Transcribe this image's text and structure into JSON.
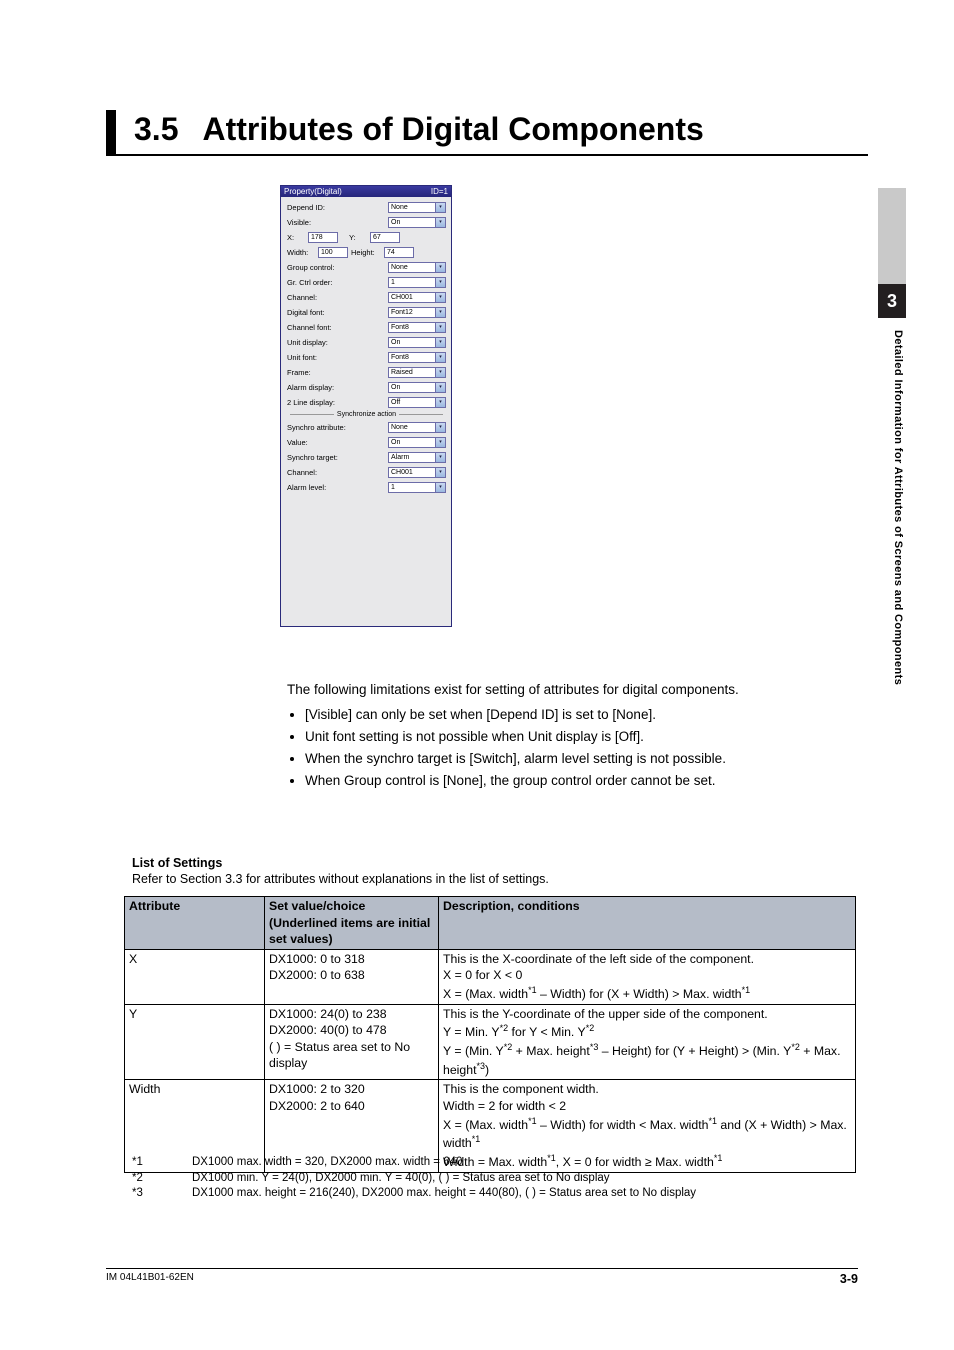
{
  "sideTab": {
    "number": "3",
    "label": "Detailed Information for Attributes of Screens and Components"
  },
  "heading": {
    "num": "3.5",
    "title": "Attributes of Digital Components"
  },
  "panel": {
    "title": "Property(Digital)",
    "titleRight": "ID=1",
    "rows": [
      {
        "label": "Depend ID:",
        "value": "None",
        "type": "combo"
      },
      {
        "label": "Visible:",
        "value": "On",
        "type": "combo"
      }
    ],
    "xy": {
      "xlabel": "X:",
      "x": "178",
      "ylabel": "Y:",
      "y": "67"
    },
    "wh": {
      "wlabel": "Width:",
      "w": "100",
      "hlabel": "Height:",
      "h": "74"
    },
    "rows2": [
      {
        "label": "Group control:",
        "value": "None",
        "type": "combo"
      },
      {
        "label": "Gr. Ctrl order:",
        "value": "1",
        "type": "combo"
      },
      {
        "label": "Channel:",
        "value": "CH001",
        "type": "combo"
      },
      {
        "label": "Digital font:",
        "value": "Font12",
        "type": "combo"
      },
      {
        "label": "Channel font:",
        "value": "Font8",
        "type": "combo"
      },
      {
        "label": "Unit display:",
        "value": "On",
        "type": "combo"
      },
      {
        "label": "Unit font:",
        "value": "Font8",
        "type": "combo"
      },
      {
        "label": "Frame:",
        "value": "Raised",
        "type": "combo"
      },
      {
        "label": "Alarm display:",
        "value": "On",
        "type": "combo"
      },
      {
        "label": "2 Line display:",
        "value": "Off",
        "type": "combo"
      }
    ],
    "sep": "Synchronize action",
    "rows3": [
      {
        "label": "Synchro attribute:",
        "value": "None",
        "type": "combo"
      },
      {
        "label": "Value:",
        "value": "On",
        "type": "combo"
      },
      {
        "label": "Synchro target:",
        "value": "Alarm",
        "type": "combo"
      },
      {
        "label": "Channel:",
        "value": "CH001",
        "type": "combo"
      },
      {
        "label": "Alarm level:",
        "value": "1",
        "type": "combo"
      }
    ]
  },
  "bodyIntro": "The following limitations exist for setting of attributes for digital components.",
  "bullets": [
    "[Visible] can only be set when [Depend ID] is set to [None].",
    "Unit font setting is not possible when Unit display is [Off].",
    "When the synchro target is [Switch], alarm level setting is not possible.",
    "When Group control is [None], the group control order cannot be set."
  ],
  "los": {
    "heading": "List of Settings",
    "sub": "Refer to Section 3.3 for attributes without explanations in the list of settings."
  },
  "table": {
    "headers": {
      "attr": "Attribute",
      "set": "Set value/choice\n(Underlined items are initial set values)",
      "desc": "Description, conditions"
    },
    "rows": [
      {
        "attr": "X",
        "set": "DX1000: 0 to 318\nDX2000: 0 to 638",
        "desc_lines": [
          "This is the X-coordinate of the left side of the component.",
          "X = 0 for X < 0",
          "X = (Max. width*1 – Width) for (X + Width) > Max. width*1"
        ]
      },
      {
        "attr": "Y",
        "set": "DX1000: 24(0) to 238\nDX2000: 40(0) to 478\n(   ) = Status area set to No display",
        "desc_lines": [
          "This is the Y-coordinate of the upper side of the component.",
          "Y = Min. Y*2 for Y < Min. Y*2",
          "Y = (Min. Y*2 + Max. height*3 – Height) for (Y + Height) > (Min. Y*2 + Max. height*3)"
        ]
      },
      {
        "attr": "Width",
        "set": "DX1000: 2 to 320\nDX2000: 2 to 640",
        "desc_lines": [
          "This is the component width.",
          "Width = 2 for width < 2",
          "X = (Max. width*1 – Width) for width < Max. width*1 and (X + Width) > Max. width*1",
          "Width = Max. width*1, X = 0 for width ≥ Max. width*1"
        ]
      }
    ]
  },
  "footnotes": [
    {
      "mark": "*1",
      "text": "DX1000 max. width = 320, DX2000 max. width = 640"
    },
    {
      "mark": "*2",
      "text": "DX1000 min. Y = 24(0), DX2000 min. Y = 40(0), (   ) = Status area set to No display"
    },
    {
      "mark": "*3",
      "text": "DX1000 max. height = 216(240), DX2000 max. height = 440(80), (   ) = Status area set to No display"
    }
  ],
  "footer": {
    "doc": "IM 04L41B01-62EN",
    "page": "3-9"
  }
}
